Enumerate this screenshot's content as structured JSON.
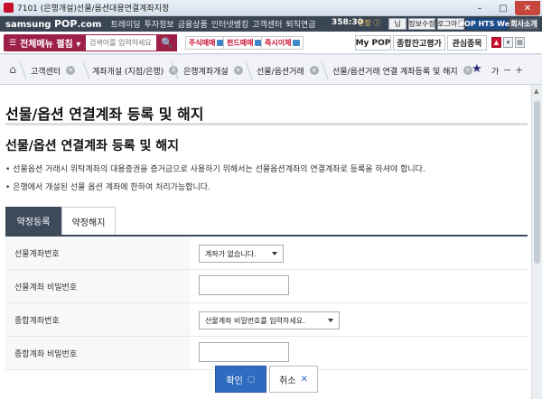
{
  "window": {
    "title": "7101 (은행개설)선물/옵션대용연결계좌지정",
    "min": "–",
    "max": "□",
    "close": "✕"
  },
  "brand": {
    "logo_pre": "samsung ",
    "logo_main": "POP",
    "logo_post": ".com",
    "nav": [
      "트레이딩",
      "투자정보",
      "금융상품",
      "인터넷뱅킹",
      "고객센터",
      "퇴직연금"
    ],
    "time": "358:30",
    "time_label": "연장 ⓘ",
    "buttons": {
      "user": "님",
      "info": "정보수정",
      "logout": "로그아웃",
      "hts": "POP HTS Web",
      "company": "회사소개"
    }
  },
  "menubar": {
    "all_menu_icon": "☰",
    "all_menu": "전체메뉴 펼침 ▾",
    "search_placeholder": "검색어를 입력하세요.",
    "search_icon": "🔍",
    "quick": [
      "주식매매",
      "펀드매매",
      "즉시이체"
    ],
    "right": [
      "My POP",
      "종합잔고평가",
      "관심종목"
    ],
    "squares": [
      "▲",
      "▾",
      "▤"
    ]
  },
  "tabbar": {
    "home_icon": "⌂",
    "tabs": [
      "고객센터",
      "계좌개설 (지점/은행)",
      "은행계좌개설",
      "선물/옵션거래",
      "선물/옵션거래 연결 계좌등록 및 해지"
    ],
    "close_glyph": "✕",
    "star": "★",
    "ga": "가",
    "minus": "−",
    "plus": "+"
  },
  "content": {
    "page_title": "선물/옵션 연결계좌 등록 및 해지",
    "section_title": "선물/옵션 연결계좌 등록 및 해지",
    "notices": [
      "• 선물옵션 거래시 위탁계좌의 대용증권을 증거금으로 사용하기 위해서는 선물옵션계좌의 연결계좌로 등록을 하셔야 합니다.",
      "• 은행에서 개설된 선물 옵션 계좌에 한하여 처리가능합니다."
    ],
    "tabs": {
      "register": "약정등록",
      "cancel": "약정해지"
    },
    "fields": [
      {
        "label": "선물계좌번호",
        "type": "select",
        "value": "계좌가 없습니다."
      },
      {
        "label": "선물계좌 비밀번호",
        "type": "input",
        "value": ""
      },
      {
        "label": "종합계좌번호",
        "type": "select",
        "value": "선물계좌 비밀번호를 입력하세요."
      },
      {
        "label": "종합계좌 비밀번호",
        "type": "input",
        "value": ""
      }
    ],
    "buttons": {
      "ok": "확인",
      "ok_icon": "◌",
      "cancel": "취소",
      "cancel_icon": "✕"
    }
  },
  "colors": {
    "brand": "#9d2048",
    "nav_dark": "#3b4654",
    "tab_active": "#3e4a5a",
    "primary": "#2e6cc0"
  }
}
